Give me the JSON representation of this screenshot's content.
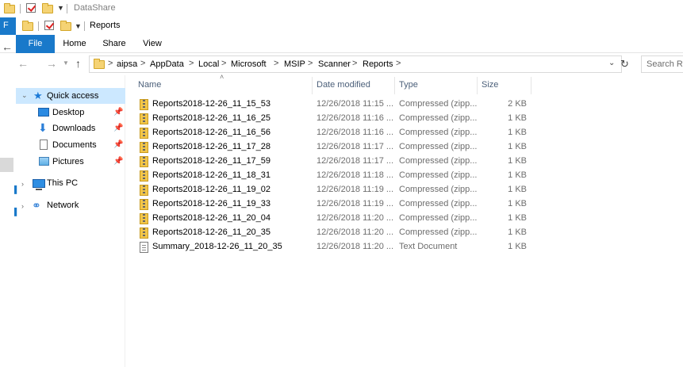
{
  "background_window": {
    "title": "DataShare"
  },
  "window": {
    "title": "Reports",
    "menu_letter": "F"
  },
  "ribbon": {
    "tabs": [
      "File",
      "Home",
      "Share",
      "View"
    ]
  },
  "address": {
    "crumbs": [
      "aipsa",
      "AppData",
      "Local",
      "Microsoft",
      "MSIP",
      "Scanner",
      "Reports"
    ],
    "separator": ">"
  },
  "search": {
    "placeholder": "Search Rep"
  },
  "nav_pane": {
    "quick_access": "Quick access",
    "pinned": [
      "Desktop",
      "Downloads",
      "Documents",
      "Pictures"
    ],
    "this_pc": "This PC",
    "network": "Network"
  },
  "columns": {
    "name": "Name",
    "date": "Date modified",
    "type": "Type",
    "size": "Size"
  },
  "files": [
    {
      "name": "Reports2018-12-26_11_15_53",
      "date": "12/26/2018 11:15 ...",
      "type": "Compressed (zipp...",
      "size": "2 KB",
      "icon": "zip-file-icon"
    },
    {
      "name": "Reports2018-12-26_11_16_25",
      "date": "12/26/2018 11:16 ...",
      "type": "Compressed (zipp...",
      "size": "1 KB",
      "icon": "zip-file-icon"
    },
    {
      "name": "Reports2018-12-26_11_16_56",
      "date": "12/26/2018 11:16 ...",
      "type": "Compressed (zipp...",
      "size": "1 KB",
      "icon": "zip-file-icon"
    },
    {
      "name": "Reports2018-12-26_11_17_28",
      "date": "12/26/2018 11:17 ...",
      "type": "Compressed (zipp...",
      "size": "1 KB",
      "icon": "zip-file-icon"
    },
    {
      "name": "Reports2018-12-26_11_17_59",
      "date": "12/26/2018 11:17 ...",
      "type": "Compressed (zipp...",
      "size": "1 KB",
      "icon": "zip-file-icon"
    },
    {
      "name": "Reports2018-12-26_11_18_31",
      "date": "12/26/2018 11:18 ...",
      "type": "Compressed (zipp...",
      "size": "1 KB",
      "icon": "zip-file-icon"
    },
    {
      "name": "Reports2018-12-26_11_19_02",
      "date": "12/26/2018 11:19 ...",
      "type": "Compressed (zipp...",
      "size": "1 KB",
      "icon": "zip-file-icon"
    },
    {
      "name": "Reports2018-12-26_11_19_33",
      "date": "12/26/2018 11:19 ...",
      "type": "Compressed (zipp...",
      "size": "1 KB",
      "icon": "zip-file-icon"
    },
    {
      "name": "Reports2018-12-26_11_20_04",
      "date": "12/26/2018 11:20 ...",
      "type": "Compressed (zipp...",
      "size": "1 KB",
      "icon": "zip-file-icon"
    },
    {
      "name": "Reports2018-12-26_11_20_35",
      "date": "12/26/2018 11:20 ...",
      "type": "Compressed (zipp...",
      "size": "1 KB",
      "icon": "zip-file-icon"
    },
    {
      "name": "Summary_2018-12-26_11_20_35",
      "date": "12/26/2018 11:20 ...",
      "type": "Text Document",
      "size": "1 KB",
      "icon": "text-file-icon"
    }
  ],
  "colors": {
    "accent": "#1979ca",
    "selection": "#cce8ff",
    "header_text": "#4c607a"
  }
}
